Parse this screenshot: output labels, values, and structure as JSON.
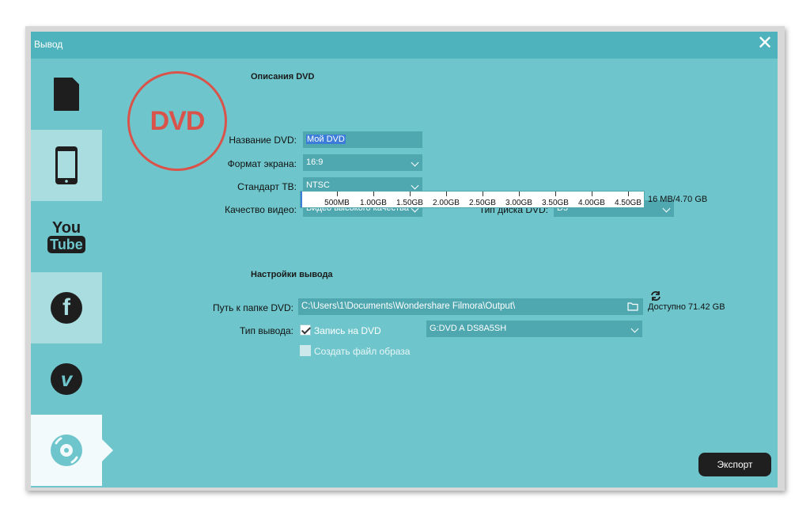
{
  "window": {
    "title": "Вывод",
    "close_glyph": "✕"
  },
  "sidebar": {
    "items": [
      {
        "name": "device-file",
        "icon": "file-icon"
      },
      {
        "name": "device-phone",
        "icon": "phone-icon"
      },
      {
        "name": "youtube",
        "icon": "youtube-icon",
        "text_top": "You",
        "text_bottom": "Tube"
      },
      {
        "name": "facebook",
        "icon": "facebook-icon",
        "text": "f"
      },
      {
        "name": "vimeo",
        "icon": "vimeo-icon",
        "text": "v"
      },
      {
        "name": "dvd",
        "icon": "disc-icon"
      }
    ]
  },
  "dvd_logo": "DVD",
  "dvd_desc": {
    "section_title": "Описания DVD",
    "name_label": "Название DVD:",
    "name_value": "Мой DVD",
    "aspect_label": "Формат экрана:",
    "aspect_value": "16:9",
    "tv_label": "Стандарт ТВ:",
    "tv_value": "NTSC",
    "quality_label": "Качество видео:",
    "quality_value": "Видео высокого качества",
    "disc_label": "Тип диска DVD:",
    "disc_value": "D5",
    "scale_ticks": [
      "500MB",
      "1.00GB",
      "1.50GB",
      "2.00GB",
      "2.50GB",
      "3.00GB",
      "3.50GB",
      "4.00GB",
      "4.50GB"
    ],
    "size_text": "16 MB/4.70 GB"
  },
  "output": {
    "section_title": "Настройки вывода",
    "path_label": "Путь к папке DVD:",
    "path_value": "C:\\Users\\1\\Documents\\Wondershare Filmora\\Output\\",
    "free_text": "Доступно 71.42 GB",
    "type_label": "Тип вывода:",
    "burn_label": "Запись на DVD",
    "burn_checked": true,
    "drive_value": "G:DVD A DS8A5SH",
    "image_label": "Создать файл образа",
    "image_checked": false
  },
  "export_label": "Экспорт",
  "colors": {
    "teal": "#6ec6cc",
    "title_bar": "#4fb3bd",
    "field": "#4fa7b0",
    "dvd_red": "#d9534a"
  }
}
